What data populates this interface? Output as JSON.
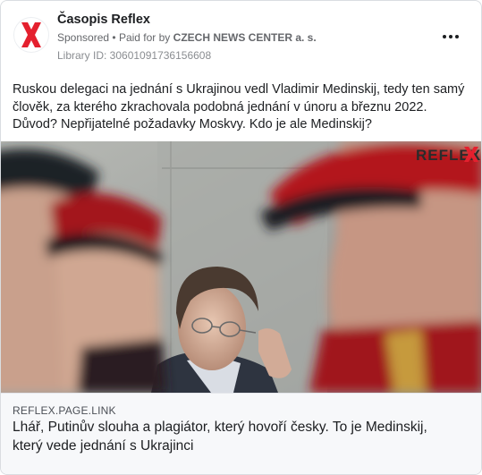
{
  "post": {
    "page_name": "Časopis Reflex",
    "sponsored": "Sponsored",
    "separator": "•",
    "paid_for_prefix": "Paid for by",
    "paid_for_by": "CZECH NEWS CENTER a. s.",
    "library_id": "Library ID: 306010917361566​08",
    "more_icon": "more-horizontal-icon",
    "body_text": "Ruskou delegaci na jednání s Ukrajinou vedl Vladimir Medinskij, tedy ten samý člověk, za kterého zkrachovala podobná jednání v únoru a březnu 2022. Důvod? Nepřijatelné požadavky Moskvy. Kdo je ale Medinskij?"
  },
  "media": {
    "watermark_logo": "REFLEX",
    "accent_color": "#e4202e"
  },
  "link": {
    "domain": "REFLEX.PAGE.LINK",
    "title": "Lhář, Putinův slouha a plagiátor, který hovoří česky. To je Medinskij, který vede jednání s Ukrajinci"
  },
  "colors": {
    "brand_red": "#e4202e",
    "text_primary": "#1c1e21",
    "text_secondary": "#65676b"
  }
}
